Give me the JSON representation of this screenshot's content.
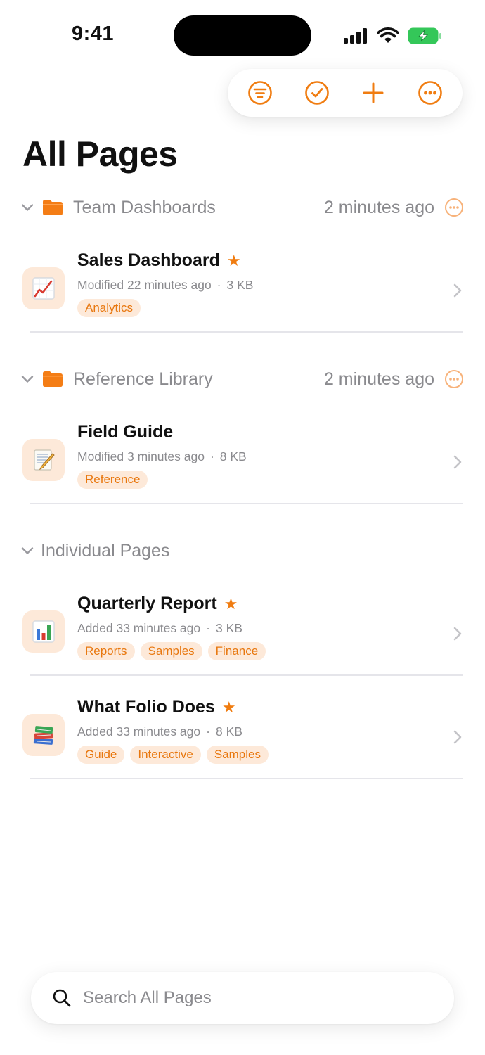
{
  "status_bar": {
    "time": "9:41"
  },
  "toolbar": {
    "filter_icon": "filter-circle-icon",
    "select_icon": "checkmark-circle-icon",
    "add_icon": "plus-icon",
    "more_icon": "ellipsis-circle-icon"
  },
  "page_title": "All Pages",
  "sections": [
    {
      "name": "Team Dashboards",
      "time": "2 minutes ago",
      "items": [
        {
          "title": "Sales Dashboard",
          "starred": true,
          "meta_prefix": "Modified 22 minutes ago",
          "size": "3 KB",
          "icon": "chart-up-icon",
          "tags": [
            "Analytics"
          ]
        }
      ]
    },
    {
      "name": "Reference Library",
      "time": "2 minutes ago",
      "items": [
        {
          "title": "Field Guide",
          "starred": false,
          "meta_prefix": "Modified 3 minutes ago",
          "size": "8 KB",
          "icon": "memo-icon",
          "tags": [
            "Reference"
          ]
        }
      ]
    },
    {
      "name": "Individual Pages",
      "items": [
        {
          "title": "Quarterly Report",
          "starred": true,
          "meta_prefix": "Added 33 minutes ago",
          "size": "3 KB",
          "icon": "bar-chart-icon",
          "tags": [
            "Reports",
            "Samples",
            "Finance"
          ]
        },
        {
          "title": "What Folio Does",
          "starred": true,
          "meta_prefix": "Added 33 minutes ago",
          "size": "8 KB",
          "icon": "books-icon",
          "tags": [
            "Guide",
            "Interactive",
            "Samples"
          ]
        }
      ]
    }
  ],
  "separator": "·",
  "star_glyph": "★",
  "search": {
    "placeholder": "Search All Pages"
  },
  "colors": {
    "accent": "#F07C10",
    "tag_bg": "#FDE9D9",
    "secondary_text": "#8A8A8E",
    "divider": "#E5E5EA"
  }
}
